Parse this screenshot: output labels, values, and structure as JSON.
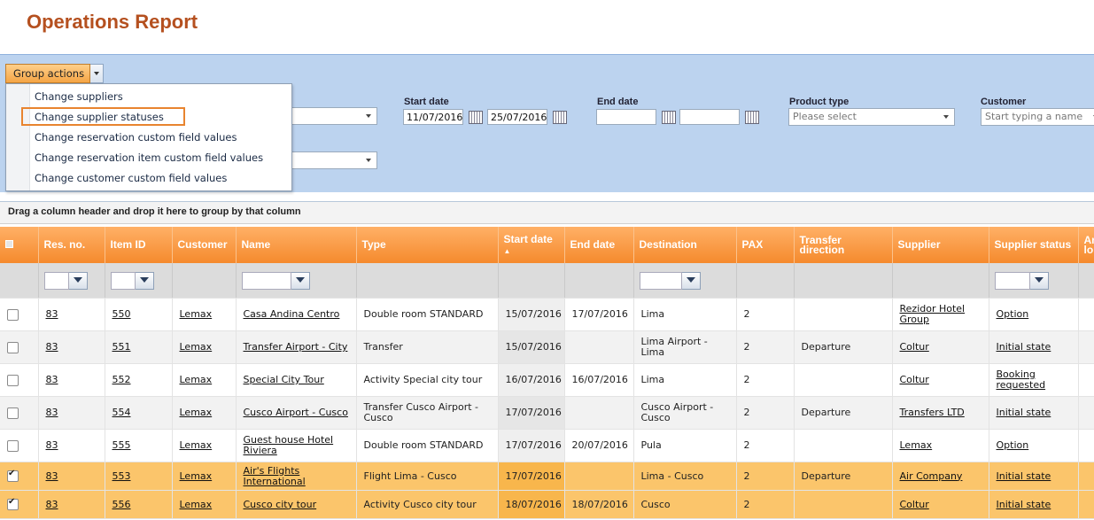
{
  "page": {
    "title": "Operations Report"
  },
  "group_actions": {
    "label": "Group actions",
    "menu": [
      "Change suppliers",
      "Change supplier statuses",
      "Change reservation custom field values",
      "Change reservation item custom field values",
      "Change customer custom field values"
    ]
  },
  "filters": {
    "start_date_label": "Start date",
    "start_from": "11/07/2016",
    "start_to": "25/07/2016",
    "end_date_label": "End date",
    "end_from": "",
    "end_to": "",
    "product_type_label": "Product type",
    "product_type_placeholder": "Please select",
    "customer_label": "Customer",
    "customer_placeholder": "Start typing a name"
  },
  "grid": {
    "group_hint": "Drag a column header and drop it here to group by that column",
    "columns": [
      "Res. no.",
      "Item ID",
      "Customer",
      "Name",
      "Type",
      "Start date",
      "End date",
      "Destination",
      "PAX",
      "Transfer direction",
      "Supplier",
      "Supplier status",
      "Ar lo"
    ],
    "rows": [
      {
        "selected": false,
        "res": "83",
        "item": "550",
        "customer": "Lemax",
        "name": "Casa Andina Centro",
        "type": "Double room STANDARD",
        "start": "15/07/2016",
        "end": "17/07/2016",
        "dest": "Lima",
        "pax": "2",
        "dir": "",
        "supplier": "Rezidor Hotel Group",
        "status": "Option"
      },
      {
        "selected": false,
        "res": "83",
        "item": "551",
        "customer": "Lemax",
        "name": "Transfer Airport - City",
        "type": "Transfer",
        "start": "15/07/2016",
        "end": "",
        "dest": "Lima Airport - Lima",
        "pax": "2",
        "dir": "Departure",
        "supplier": "Coltur",
        "status": "Initial state"
      },
      {
        "selected": false,
        "res": "83",
        "item": "552",
        "customer": "Lemax",
        "name": "Special City Tour",
        "type": "Activity Special city tour",
        "start": "16/07/2016",
        "end": "16/07/2016",
        "dest": "Lima",
        "pax": "2",
        "dir": "",
        "supplier": "Coltur",
        "status": "Booking requested"
      },
      {
        "selected": false,
        "res": "83",
        "item": "554",
        "customer": "Lemax",
        "name": "Cusco Airport - Cusco",
        "type": "Transfer Cusco Airport - Cusco",
        "start": "17/07/2016",
        "end": "",
        "dest": "Cusco Airport - Cusco",
        "pax": "2",
        "dir": "Departure",
        "supplier": "Transfers LTD",
        "status": "Initial state"
      },
      {
        "selected": false,
        "res": "83",
        "item": "555",
        "customer": "Lemax",
        "name": "Guest house Hotel Riviera",
        "type": "Double room STANDARD",
        "start": "17/07/2016",
        "end": "20/07/2016",
        "dest": "Pula",
        "pax": "2",
        "dir": "",
        "supplier": "Lemax",
        "status": "Option"
      },
      {
        "selected": true,
        "res": "83",
        "item": "553",
        "customer": "Lemax",
        "name": "Air's Flights International",
        "type": "Flight Lima - Cusco",
        "start": "17/07/2016",
        "end": "",
        "dest": "Lima - Cusco",
        "pax": "2",
        "dir": "Departure",
        "supplier": "Air Company",
        "status": "Initial state"
      },
      {
        "selected": true,
        "res": "83",
        "item": "556",
        "customer": "Lemax",
        "name": "Cusco city tour",
        "type": "Activity Cusco city tour",
        "start": "18/07/2016",
        "end": "18/07/2016",
        "dest": "Cusco",
        "pax": "2",
        "dir": "",
        "supplier": "Coltur",
        "status": "Initial state"
      }
    ]
  }
}
